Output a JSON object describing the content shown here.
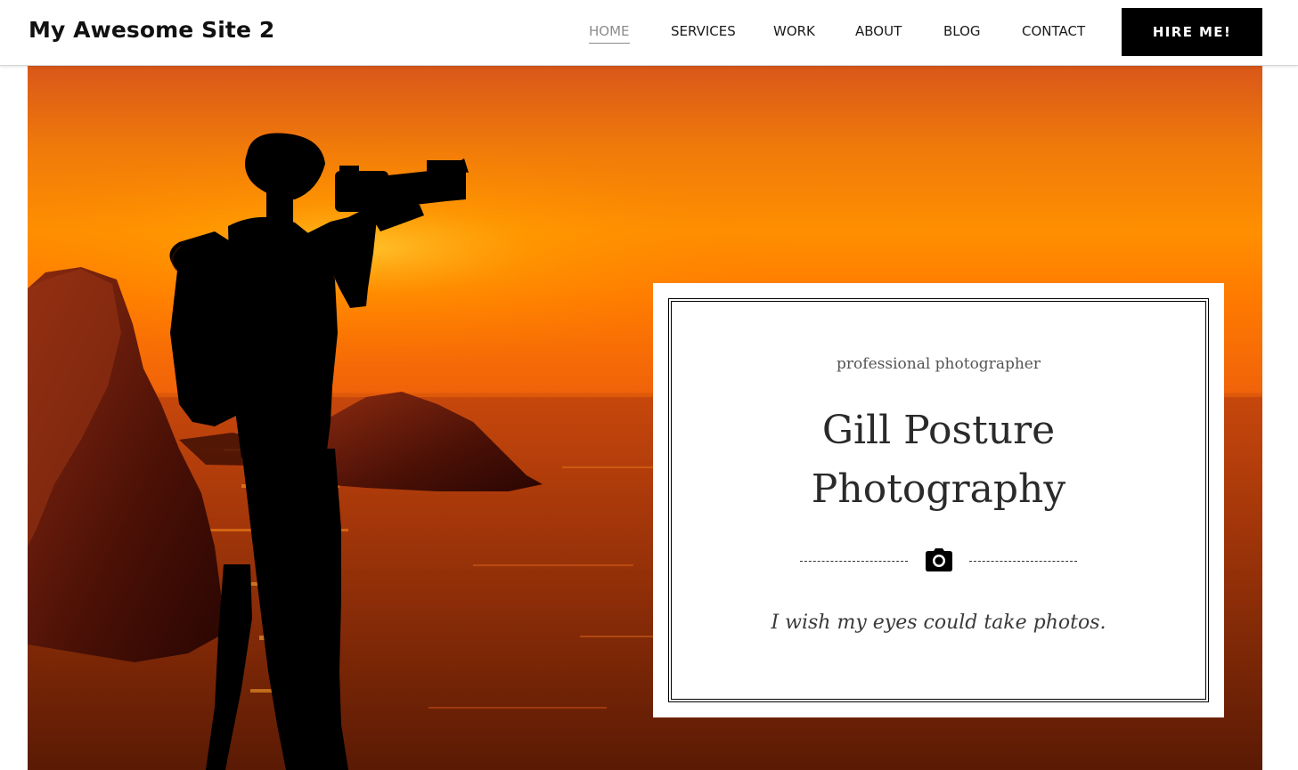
{
  "header": {
    "site_title": "My Awesome Site 2",
    "nav": [
      {
        "label": "HOME",
        "active": true
      },
      {
        "label": "SERVICES",
        "active": false
      },
      {
        "label": "WORK",
        "active": false
      },
      {
        "label": "ABOUT",
        "active": false
      },
      {
        "label": "BLOG",
        "active": false
      },
      {
        "label": "CONTACT",
        "active": false
      }
    ],
    "cta_label": "HIRE ME!"
  },
  "hero": {
    "image": "photographer-silhouette-sunset",
    "card": {
      "subtitle": "professional photographer",
      "title_line1": "Gill Posture",
      "title_line2": "Photography",
      "icon": "camera-icon",
      "quote": "I wish my eyes could take photos."
    }
  },
  "colors": {
    "accent": "#000000",
    "active_nav": "#8c8c8c",
    "sky_top": "#d85a10",
    "sky_mid": "#ff8a00",
    "sea": "#7a2a08"
  }
}
